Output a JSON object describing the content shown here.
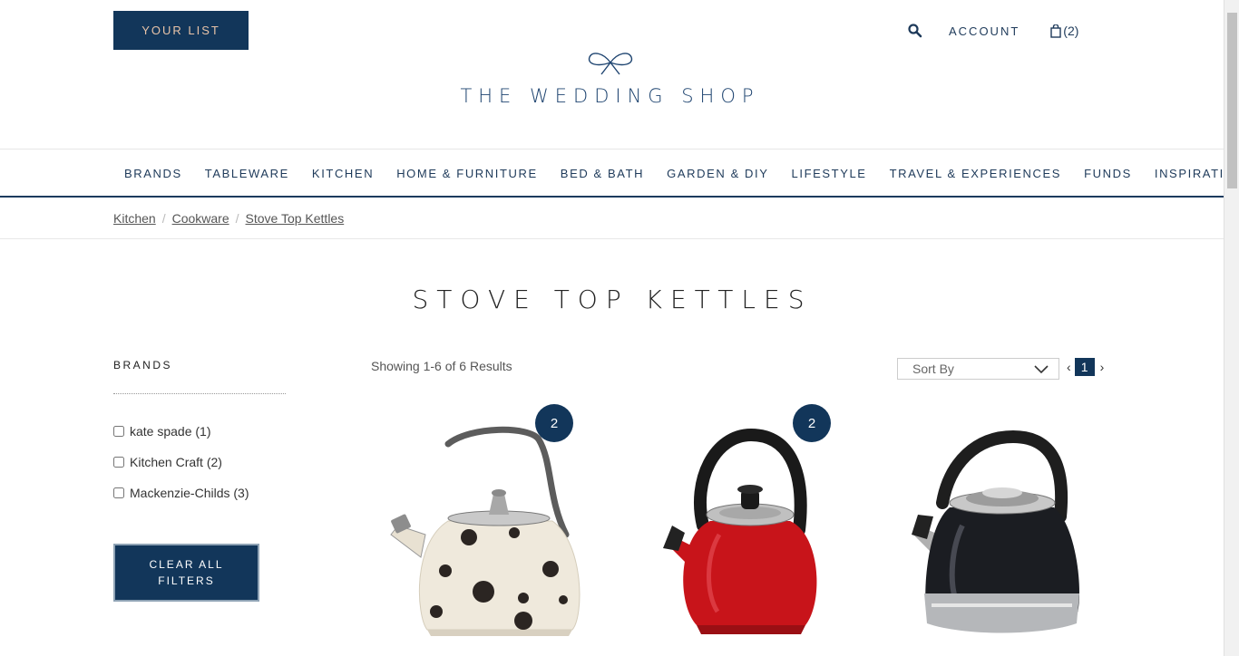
{
  "header": {
    "your_list_label": "YOUR LIST",
    "logo_text": "THE WEDDING SHOP",
    "account_label": "ACCOUNT",
    "cart_count": "(2)"
  },
  "nav": {
    "items": [
      "BRANDS",
      "TABLEWARE",
      "KITCHEN",
      "HOME & FURNITURE",
      "BED & BATH",
      "GARDEN & DIY",
      "LIFESTYLE",
      "TRAVEL & EXPERIENCES",
      "FUNDS",
      "INSPIRATION"
    ]
  },
  "breadcrumb": {
    "items": [
      "Kitchen",
      "Cookware",
      "Stove Top Kettles"
    ],
    "separator": "/"
  },
  "page": {
    "title": "STOVE TOP KETTLES"
  },
  "sidebar": {
    "heading": "BRANDS",
    "filters": [
      {
        "label": "kate spade (1)",
        "checked": false
      },
      {
        "label": "Kitchen Craft (2)",
        "checked": false
      },
      {
        "label": "Mackenzie-Childs (3)",
        "checked": false
      }
    ],
    "clear_label": "CLEAR ALL FILTERS"
  },
  "results": {
    "count_text": "Showing 1-6 of 6 Results",
    "sort_label": "Sort By",
    "current_page": "1",
    "prev": "‹",
    "next": "›"
  },
  "products": [
    {
      "badge": "2",
      "image": "cream-polka-dot-kettle",
      "body_color": "#efe9dc",
      "accent_color": "#2b2522"
    },
    {
      "badge": "2",
      "image": "red-kettle",
      "body_color": "#c8141a",
      "accent_color": "#1a1a1a"
    },
    {
      "badge": "",
      "image": "black-steel-kettle",
      "body_color": "#1b1d22",
      "accent_color": "#b5b7ba"
    }
  ],
  "colors": {
    "brand_navy": "#12365a",
    "your_list_text": "#e8c3a8"
  }
}
